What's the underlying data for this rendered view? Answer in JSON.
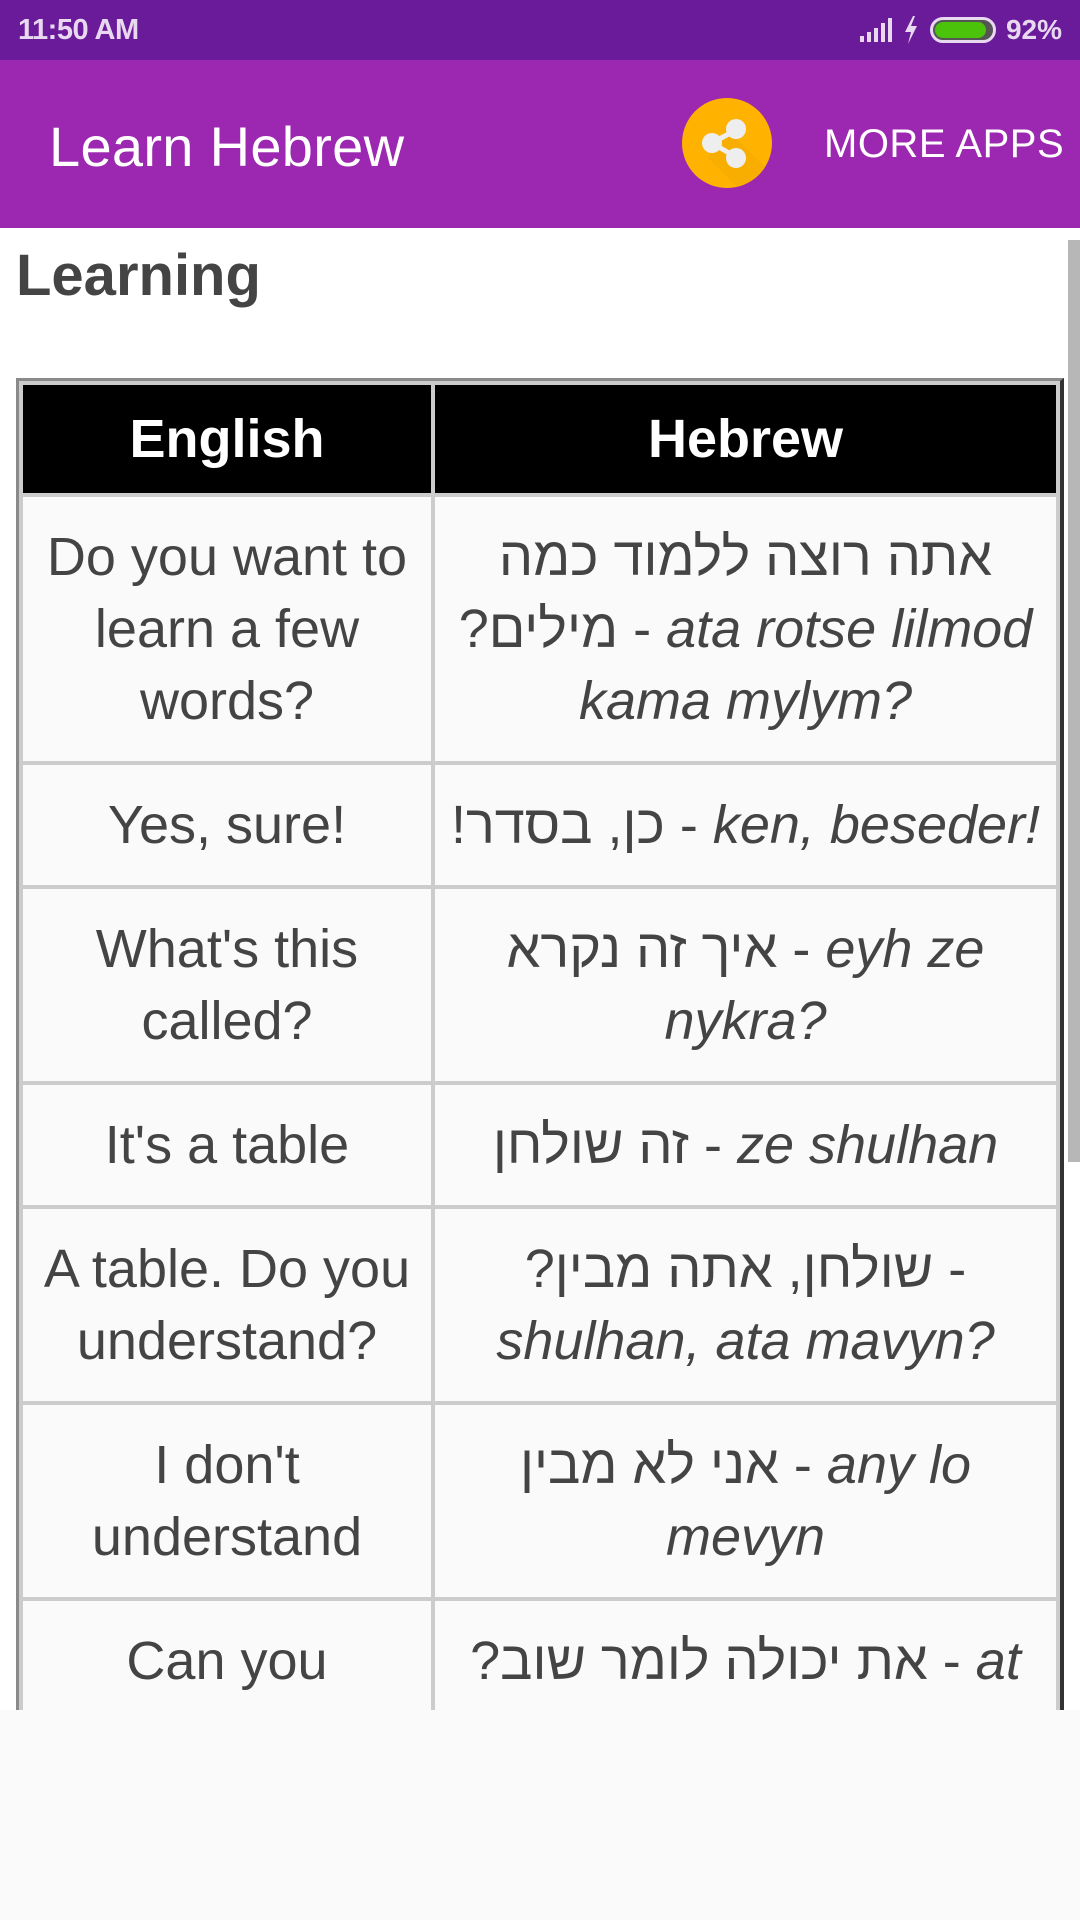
{
  "status_bar": {
    "time": "11:50 AM",
    "battery_percent": "92%",
    "battery_level": 0.92,
    "icons": [
      "signal-icon",
      "charging-icon",
      "battery-icon"
    ]
  },
  "app_bar": {
    "title": "Learn Hebrew",
    "share_icon": "share-icon",
    "more_apps_label": "MORE APPS",
    "colors": {
      "app_bar": "#9c27b0",
      "status_bar": "#6a1b9a",
      "share_button": "#ffb300"
    }
  },
  "page": {
    "heading": "Learning"
  },
  "table": {
    "headers": [
      "English",
      "Hebrew"
    ],
    "rows": [
      {
        "english": "Do you want to learn a few words?",
        "hebrew": "אתה רוצה ללמוד כמה מילים?",
        "translit": "ata rotse lilmod kama mylym?"
      },
      {
        "english": "Yes, sure!",
        "hebrew": "כן, בסדר!",
        "translit": "ken, beseder!"
      },
      {
        "english": "What's this called?",
        "hebrew": "איך זה נקרא",
        "translit": "eyh ze nykra?"
      },
      {
        "english": "It's a table",
        "hebrew": "זה שולחן",
        "translit": "ze shulhan"
      },
      {
        "english": "A table. Do you understand?",
        "hebrew": "שולחן, אתה מבין?",
        "translit": "shulhan, ata mavyn?"
      },
      {
        "english": "I don't understand",
        "hebrew": "אני לא מבין",
        "translit": "any lo mevyn"
      },
      {
        "english": "Can you repeat?",
        "hebrew": "את יכולה לומר שוב?",
        "translit": "at yakhola lomar shuv?"
      }
    ]
  }
}
